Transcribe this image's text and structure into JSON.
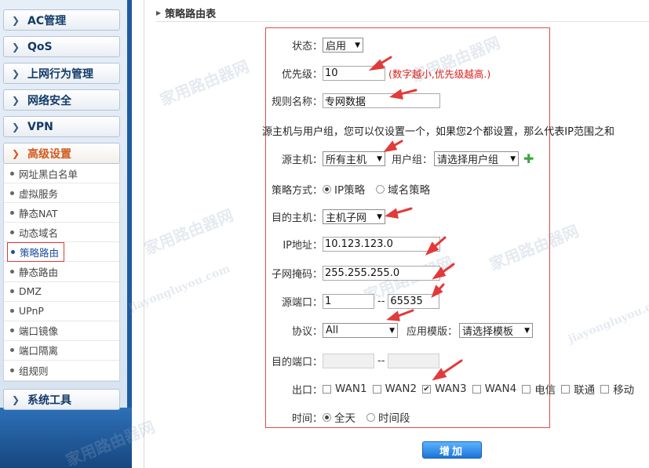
{
  "sidebar": {
    "menu": [
      {
        "label": "AC管理"
      },
      {
        "label": "QoS"
      },
      {
        "label": "上网行为管理"
      },
      {
        "label": "网络安全"
      },
      {
        "label": "VPN"
      },
      {
        "label": "高级设置"
      },
      {
        "label": "系统工具"
      }
    ],
    "submenu": [
      {
        "label": "网址黑白名单"
      },
      {
        "label": "虚拟服务"
      },
      {
        "label": "静态NAT"
      },
      {
        "label": "动态域名"
      },
      {
        "label": "策略路由"
      },
      {
        "label": "静态路由"
      },
      {
        "label": "DMZ"
      },
      {
        "label": "UPnP"
      },
      {
        "label": "端口镜像"
      },
      {
        "label": "端口隔离"
      },
      {
        "label": "组规则"
      }
    ]
  },
  "main": {
    "section_title": "策略路由表",
    "form": {
      "status_label": "状态：",
      "status_value": "启用",
      "priority_label": "优先级：",
      "priority_value": "10",
      "priority_hint": "(数字越小,优先级越高.)",
      "rule_name_label": "规则名称：",
      "rule_name_value": "专网数据",
      "note": "源主机与用户组，您可以仅设置一个，如果您2个都设置，那么代表IP范围之和",
      "src_host_label": "源主机：",
      "src_host_value": "所有主机",
      "user_group_label": "用户组：",
      "user_group_value": "请选择用户组",
      "policy_mode_label": "策略方式：",
      "policy_mode_ip": "IP策略",
      "policy_mode_domain": "域名策略",
      "dst_host_label": "目的主机：",
      "dst_host_value": "主机子网",
      "ip_label": "IP地址：",
      "ip_value": "10.123.123.0",
      "mask_label": "子网掩码：",
      "mask_value": "255.255.255.0",
      "src_port_label": "源端口：",
      "src_port_from": "1",
      "src_port_to": "65535",
      "dash": "--",
      "protocol_label": "协议：",
      "protocol_value": "All",
      "app_template_label": "应用模版：",
      "app_template_value": "请选择模板",
      "dst_port_label": "目的端口：",
      "exit_label": "出口：",
      "exits": [
        {
          "label": "WAN1",
          "checked": false
        },
        {
          "label": "WAN2",
          "checked": false
        },
        {
          "label": "WAN3",
          "checked": true
        },
        {
          "label": "WAN4",
          "checked": false
        },
        {
          "label": "电信",
          "checked": false
        },
        {
          "label": "联通",
          "checked": false
        },
        {
          "label": "移动",
          "checked": false
        }
      ],
      "time_label": "时间：",
      "time_all": "全天",
      "time_range": "时间段"
    },
    "add_button": "增加"
  },
  "watermark": {
    "cn": "家用路由器网",
    "en": "jiayongluyou.com"
  },
  "colors": {
    "sidebar_blue": "#1f5a9e",
    "active_orange": "#d2581e",
    "annotation_red": "#e23a3a",
    "hint_red": "#d8231b",
    "button_blue": "#1a74d6"
  }
}
